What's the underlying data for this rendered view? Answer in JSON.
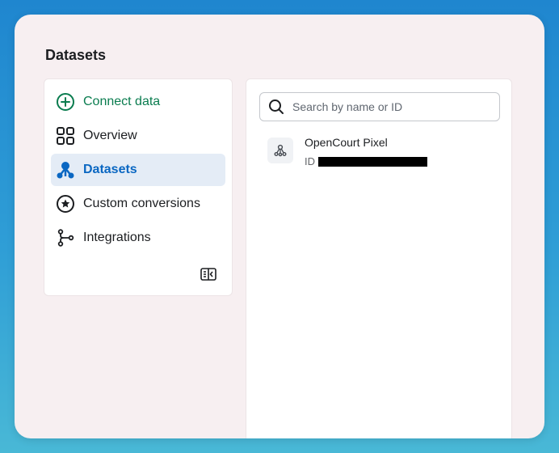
{
  "page": {
    "title": "Datasets"
  },
  "nav": {
    "items": [
      {
        "label": "Connect data",
        "icon": "plus-circle-icon",
        "state": "action"
      },
      {
        "label": "Overview",
        "icon": "grid-icon",
        "state": "normal"
      },
      {
        "label": "Datasets",
        "icon": "datasets-icon",
        "state": "active"
      },
      {
        "label": "Custom conversions",
        "icon": "star-circle-icon",
        "state": "normal"
      },
      {
        "label": "Integrations",
        "icon": "integrations-icon",
        "state": "normal"
      }
    ],
    "collapse_icon": "sidebar-collapse-icon"
  },
  "search": {
    "placeholder": "Search by name or ID",
    "value": ""
  },
  "datasets": [
    {
      "name": "OpenCourt Pixel",
      "id_label": "ID",
      "id_value": "[redacted]"
    }
  ],
  "colors": {
    "accent_green": "#0a7c4f",
    "accent_blue": "#0a67c2",
    "active_bg": "#e4ecf6"
  }
}
